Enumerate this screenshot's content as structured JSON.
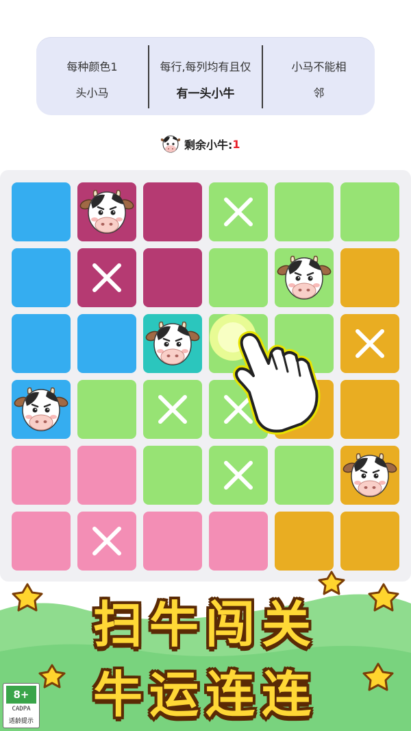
{
  "rules": [
    {
      "line1": "每种颜色1",
      "line2": "头小马"
    },
    {
      "line1": "每行,每列均有且仅",
      "line2": "有一头小牛"
    },
    {
      "line1": "小马不能相",
      "line2": "邻"
    }
  ],
  "status": {
    "label": "剩余小牛:",
    "count": "1",
    "icon": "cow-face-icon"
  },
  "colors": {
    "blue": "#35adf0",
    "magenta": "#b53a72",
    "green": "#97e374",
    "orange": "#e9ad22",
    "pink": "#f38eb5",
    "teal": "#2bc6bd",
    "mark": "#ffffff",
    "title_fill": "#ffd836",
    "title_outline": "#5a2a05"
  },
  "board": {
    "rows": [
      [
        {
          "c": "blue",
          "m": ""
        },
        {
          "c": "magenta",
          "m": "cow"
        },
        {
          "c": "magenta",
          "m": ""
        },
        {
          "c": "green",
          "m": "x"
        },
        {
          "c": "green",
          "m": ""
        },
        {
          "c": "green",
          "m": ""
        }
      ],
      [
        {
          "c": "blue",
          "m": ""
        },
        {
          "c": "magenta",
          "m": "x"
        },
        {
          "c": "magenta",
          "m": ""
        },
        {
          "c": "green",
          "m": ""
        },
        {
          "c": "green",
          "m": "cow"
        },
        {
          "c": "orange",
          "m": ""
        }
      ],
      [
        {
          "c": "blue",
          "m": ""
        },
        {
          "c": "blue",
          "m": ""
        },
        {
          "c": "teal",
          "m": "cow"
        },
        {
          "c": "green",
          "m": ""
        },
        {
          "c": "green",
          "m": ""
        },
        {
          "c": "orange",
          "m": "x"
        }
      ],
      [
        {
          "c": "blue",
          "m": "cow"
        },
        {
          "c": "green",
          "m": ""
        },
        {
          "c": "green",
          "m": "x"
        },
        {
          "c": "green",
          "m": "x"
        },
        {
          "c": "orange",
          "m": ""
        },
        {
          "c": "orange",
          "m": ""
        }
      ],
      [
        {
          "c": "pink",
          "m": ""
        },
        {
          "c": "pink",
          "m": ""
        },
        {
          "c": "green",
          "m": ""
        },
        {
          "c": "green",
          "m": "x"
        },
        {
          "c": "green",
          "m": ""
        },
        {
          "c": "orange",
          "m": "cow"
        }
      ],
      [
        {
          "c": "pink",
          "m": ""
        },
        {
          "c": "pink",
          "m": "x"
        },
        {
          "c": "pink",
          "m": ""
        },
        {
          "c": "pink",
          "m": ""
        },
        {
          "c": "orange",
          "m": ""
        },
        {
          "c": "orange",
          "m": ""
        }
      ]
    ]
  },
  "hint": {
    "icon": "pointing-hand-icon"
  },
  "banner": {
    "line1": "扫牛闯关",
    "line2": "牛运连连"
  },
  "age_rating": {
    "rating": "8+",
    "org": "CADPA",
    "note": "适龄提示"
  }
}
